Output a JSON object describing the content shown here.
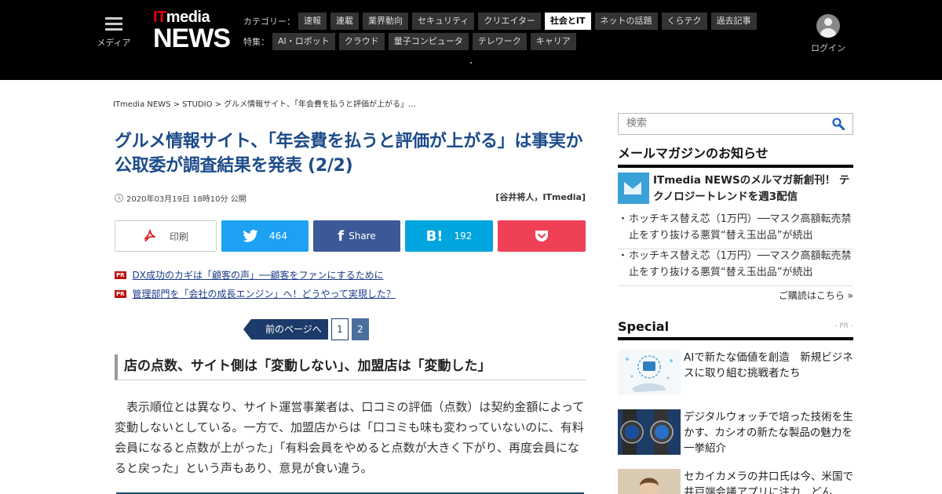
{
  "header": {
    "menu_label": "メディア",
    "logo_it": "IT",
    "logo_media": "media",
    "logo_news": "NEWS",
    "category_label": "カテゴリー：",
    "categories": [
      "速報",
      "連載",
      "業界動向",
      "セキュリティ",
      "クリエイター",
      "社会とIT",
      "ネットの話題",
      "くらテク",
      "過去記事"
    ],
    "feature_label": "特集：",
    "features": [
      "AI・ロボット",
      "クラウド",
      "量子コンピュータ",
      "テレワーク",
      "キャリア"
    ],
    "login_label": "ログイン"
  },
  "breadcrumb": "ITmedia NEWS > STUDIO > グルメ情報サイト、「年会費を払うと評価が上がる」…",
  "article": {
    "title": "グルメ情報サイト、「年会費を払うと評価が上がる」は事実か　公取委が調査結果を発表 (2/2)",
    "date": "2020年03月19日 18時10分 公開",
    "author": "[谷井将人，ITmedia]",
    "share": {
      "print_label": "印刷",
      "twitter_count": "464",
      "facebook_label": "Share",
      "hatena_count": "192"
    },
    "pr_badge": "PR",
    "pr_links": [
      "DX成功のカギは「顧客の声」──顧客をファンにするために",
      "管理部門を「会社の成長エンジン」へ！どうやって実現した？"
    ],
    "pager": {
      "prev_label": "前のページへ",
      "pages": [
        "1",
        "2"
      ],
      "current": "2"
    },
    "subhead": "店の点数、サイト側は「変動しない」、加盟店は「変動した」",
    "body": "表示順位とは異なり、サイト運営事業者は、口コミの評価（点数）は契約金額によって変動しないとしている。一方で、加盟店からは「口コミも味も変わっていないのに、有料会員になると点数が上がった」「有料会員をやめると点数が大きく下がり、再度会員になると戻った」という声もあり、意見が食い違う。"
  },
  "sidebar": {
    "search_placeholder": "検索",
    "mailmag_heading": "メールマガジンのお知らせ",
    "mailmag_feature": "ITmedia NEWSのメルマガ新創刊！ テクノロジートレンドを週3配信",
    "mailmag_items": [
      "ホッチキス替え芯（1万円）──マスク高額転売禁止をすり抜ける悪質“替え玉出品”が続出",
      "ホッチキス替え芯（1万円）──マスク高額転売禁止をすり抜ける悪質“替え玉出品”が続出"
    ],
    "mailmag_more": "ご購読はこちら »",
    "special_heading": "Special",
    "special_pr": "- PR -",
    "special_items": [
      "AIで新たな価値を創造　新規ビジネスに取り組む挑戦者たち",
      "デジタルウォッチで培った技術を生かす、カシオの新たな製品の魅力を一挙紹介",
      "セカイカメラの井口氏は今、米国で井戸端会議アプリに注力　どん"
    ]
  },
  "colors": {
    "title": "#1c4b8a",
    "twitter": "#1da1f2",
    "facebook": "#3b5998",
    "hatena": "#00a4de",
    "pocket": "#ef4056",
    "logo_red": "#e60012"
  }
}
